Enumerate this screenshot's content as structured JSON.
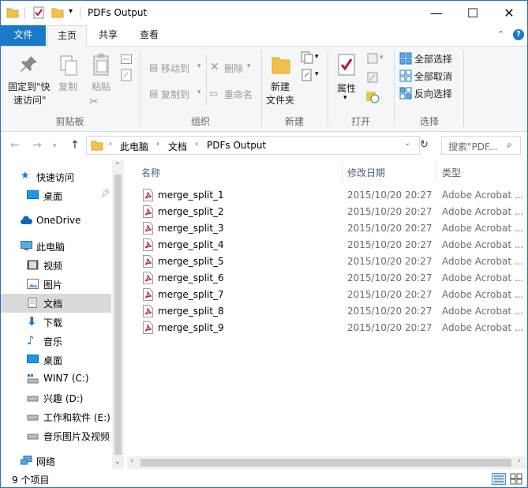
{
  "window": {
    "title": "PDFs Output"
  },
  "ribbon_tabs": {
    "file": "文件",
    "home": "主页",
    "share": "共享",
    "view": "查看"
  },
  "ribbon": {
    "clipboard": {
      "pin": "固定到\"快",
      "pin2": "速访问\"",
      "copy": "复制",
      "paste": "粘贴",
      "label": "剪贴板"
    },
    "organize": {
      "move_to": "移动到",
      "copy_to": "复制到",
      "delete": "删除",
      "rename": "重命名",
      "label": "组织"
    },
    "new": {
      "new_folder_1": "新建",
      "new_folder_2": "文件夹",
      "label": "新建"
    },
    "open": {
      "properties": "属性",
      "label": "打开"
    },
    "select": {
      "select_all": "全部选择",
      "select_none": "全部取消",
      "invert": "反向选择",
      "label": "选择"
    }
  },
  "address": {
    "crumbs": [
      "此电脑",
      "文档",
      "PDFs Output"
    ],
    "search_placeholder": "搜索\"PDF..."
  },
  "nav": {
    "quick_access": "快速访问",
    "desktop_pinned": "桌面",
    "onedrive": "OneDrive",
    "this_pc": "此电脑",
    "videos": "视频",
    "pictures": "图片",
    "documents": "文档",
    "downloads": "下载",
    "music": "音乐",
    "desktop": "桌面",
    "drive_c": "WIN7 (C:)",
    "drive_d": "兴趣 (D:)",
    "drive_e": "工作和软件 (E:)",
    "drive_f": "音乐图片及视频",
    "network": "网络"
  },
  "columns": {
    "name": "名称",
    "date": "修改日期",
    "type": "类型"
  },
  "files": [
    {
      "name": "merge_split_1",
      "date": "2015/10/20 20:27",
      "type": "Adobe Acrobat ..."
    },
    {
      "name": "merge_split_2",
      "date": "2015/10/20 20:27",
      "type": "Adobe Acrobat ..."
    },
    {
      "name": "merge_split_3",
      "date": "2015/10/20 20:27",
      "type": "Adobe Acrobat ..."
    },
    {
      "name": "merge_split_4",
      "date": "2015/10/20 20:27",
      "type": "Adobe Acrobat ..."
    },
    {
      "name": "merge_split_5",
      "date": "2015/10/20 20:27",
      "type": "Adobe Acrobat ..."
    },
    {
      "name": "merge_split_6",
      "date": "2015/10/20 20:27",
      "type": "Adobe Acrobat ..."
    },
    {
      "name": "merge_split_7",
      "date": "2015/10/20 20:27",
      "type": "Adobe Acrobat ..."
    },
    {
      "name": "merge_split_8",
      "date": "2015/10/20 20:27",
      "type": "Adobe Acrobat ..."
    },
    {
      "name": "merge_split_9",
      "date": "2015/10/20 20:27",
      "type": "Adobe Acrobat ..."
    }
  ],
  "status": {
    "count": "9 个项目"
  },
  "colors": {
    "accent": "#1979ca",
    "pdf_red": "#c8102e",
    "folder": "#f3c04b"
  }
}
